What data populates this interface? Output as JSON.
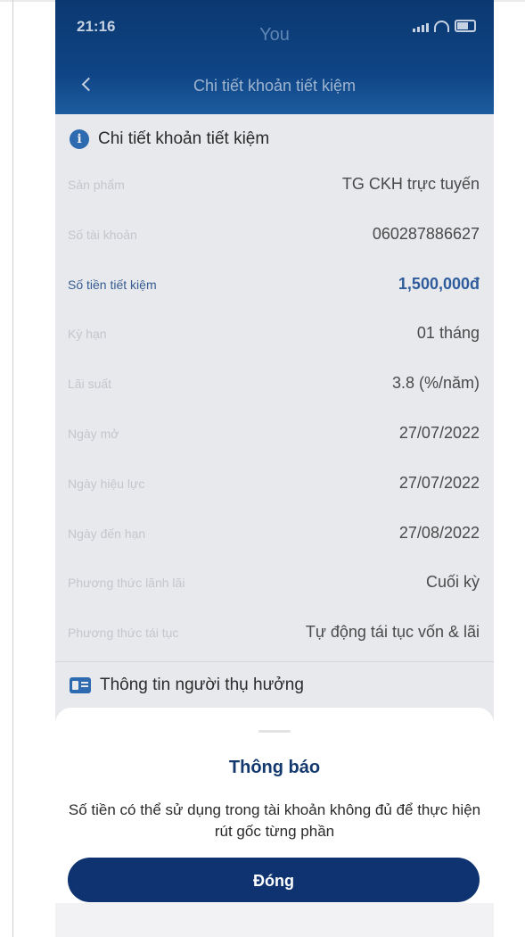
{
  "status_bar": {
    "time": "21:16",
    "carrier": "You"
  },
  "header": {
    "title": "Chi tiết khoản tiết kiệm"
  },
  "details_section": {
    "title": "Chi tiết khoản tiết kiệm",
    "rows": [
      {
        "label": "Sản phẩm",
        "value": "TG CKH trực tuyến"
      },
      {
        "label": "Số tài khoản",
        "value": "060287886627"
      },
      {
        "label": "Số tiền tiết kiệm",
        "value": "1,500,000đ"
      },
      {
        "label": "Kỳ hạn",
        "value": "01 tháng"
      },
      {
        "label": "Lãi suất",
        "value": "3.8 (%/năm)"
      },
      {
        "label": "Ngày mở",
        "value": "27/07/2022"
      },
      {
        "label": "Ngày hiệu lực",
        "value": "27/07/2022"
      },
      {
        "label": "Ngày đến hạn",
        "value": "27/08/2022"
      },
      {
        "label": "Phương thức lãnh lãi",
        "value": "Cuối kỳ"
      },
      {
        "label": "Phương thức tái tục",
        "value": "Tự động tái tục vốn & lãi"
      }
    ]
  },
  "beneficiary_section": {
    "title": "Thông tin người thụ hưởng"
  },
  "dialog": {
    "title": "Thông báo",
    "message": "Số tiền có thể sử dụng trong tài khoản không đủ để thực hiện rút gốc từng phần",
    "close_label": "Đóng"
  },
  "colors": {
    "header": "#0f4586",
    "primary_button": "#0e3370",
    "highlight_text": "#2e5c9c",
    "info_icon": "#2e6ab0"
  },
  "icons": [
    "back-icon",
    "info-icon",
    "id-card-icon",
    "signal-icon",
    "wifi-icon",
    "battery-icon"
  ]
}
